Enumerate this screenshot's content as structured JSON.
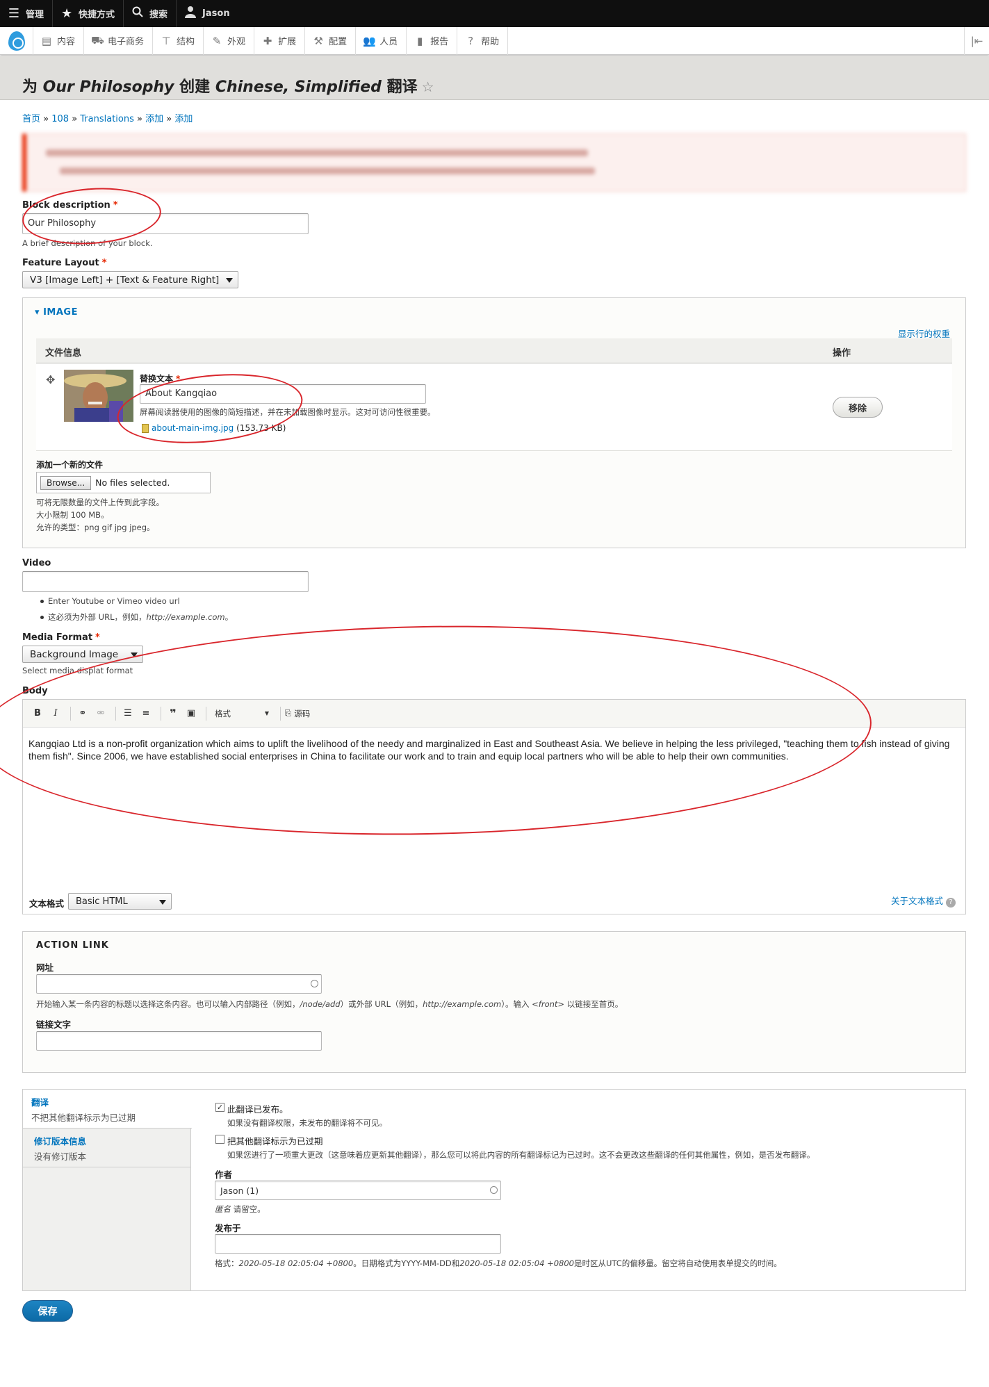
{
  "toolbar": {
    "manage": "管理",
    "shortcuts": "快捷方式",
    "search": "搜索",
    "user": "Jason",
    "menu": [
      {
        "label": "内容",
        "icon": "content-icon"
      },
      {
        "label": "电子商务",
        "icon": "commerce-icon"
      },
      {
        "label": "结构",
        "icon": "structure-icon"
      },
      {
        "label": "外观",
        "icon": "appearance-icon"
      },
      {
        "label": "扩展",
        "icon": "extend-icon"
      },
      {
        "label": "配置",
        "icon": "config-icon"
      },
      {
        "label": "人员",
        "icon": "people-icon"
      },
      {
        "label": "报告",
        "icon": "reports-icon"
      },
      {
        "label": "帮助",
        "icon": "help-icon"
      }
    ]
  },
  "page": {
    "title_prefix": "为 ",
    "title_node": "Our Philosophy",
    "title_mid": " 创建 ",
    "title_lang": "Chinese, Simplified",
    "title_suffix": " 翻译"
  },
  "breadcrumb": [
    "首页",
    "108",
    "Translations",
    "添加",
    "添加"
  ],
  "block_description": {
    "label": "Block description",
    "value": "Our Philosophy",
    "description": "A brief description of your block."
  },
  "feature_layout": {
    "label": "Feature Layout",
    "value": "V3 [Image Left] + [Text & Feature Right]"
  },
  "image": {
    "legend": "IMAGE",
    "show_weights": "显示行的权重",
    "col_file": "文件信息",
    "col_ops": "操作",
    "alt_label": "替换文本",
    "alt_value": "About Kangqiao",
    "alt_desc": "屏幕阅读器使用的图像的简短描述，并在未加载图像时显示。这对可访问性很重要。",
    "file_name": "about-main-img.jpg",
    "file_size": "(153.73 KB)",
    "remove": "移除",
    "add_new": "添加一个新的文件",
    "browse": "Browse...",
    "no_files": "No files selected.",
    "help1": "可将无限数量的文件上传到此字段。",
    "help2": "大小限制 100 MB。",
    "help3": "允许的类型：png gif jpg jpeg。"
  },
  "video": {
    "label": "Video",
    "value": "",
    "desc1": "Enter Youtube or Vimeo video url",
    "desc2_a": "这必须为外部 URL，例如，",
    "desc2_b": "http://example.com",
    "desc2_c": "。"
  },
  "media_format": {
    "label": "Media Format",
    "value": "Background Image",
    "desc": "Select media displat format"
  },
  "body": {
    "label": "Body",
    "format_dropdown": "格式",
    "source": "源码",
    "text": "Kangqiao Ltd is a non-profit organization which aims to uplift the livelihood of the needy and marginalized in East and Southeast Asia. We believe in helping the less privileged, \"teaching them to fish instead of giving them fish\". Since 2006, we have established social enterprises in China to facilitate our work and to train and equip local partners who will be able to help their own communities.",
    "text_format_label": "文本格式",
    "text_format_value": "Basic HTML",
    "about_formats": "关于文本格式"
  },
  "action_link": {
    "legend": "ACTION LINK",
    "url_label": "网址",
    "url_value": "",
    "url_desc_a": "开始输入某一条内容的标题以选择这条内容。也可以输入内部路径（例如，",
    "url_desc_b": "/node/add",
    "url_desc_c": "）或外部 URL（例如，",
    "url_desc_d": "http://example.com",
    "url_desc_e": "）。输入 ",
    "url_desc_f": "<front>",
    "url_desc_g": " 以链接至首页。",
    "text_label": "链接文字",
    "text_value": ""
  },
  "translation": {
    "tab1_title": "翻译",
    "tab1_summary": "不把其他翻译标示为已过期",
    "tab2_title": "修订版本信息",
    "tab2_summary": "没有修订版本",
    "published_label": "此翻译已发布。",
    "published_checked": true,
    "published_desc": "如果没有翻译权限，未发布的翻译将不可见。",
    "outdated_label": "把其他翻译标示为已过期",
    "outdated_checked": false,
    "outdated_desc": "如果您进行了一项重大更改（这意味着应更新其他翻译），那么您可以将此内容的所有翻译标记为已过时。这不会更改这些翻译的任何其他属性，例如，是否发布翻译。",
    "author_label": "作者",
    "author_value": "Jason (1)",
    "author_desc_a": "匿名",
    "author_desc_b": " 请留空。",
    "authored_on_label": "发布于",
    "authored_on_value": "",
    "date_desc_a": "格式：",
    "date_desc_b": "2020-05-18 02:05:04 +0800",
    "date_desc_c": "。日期格式为YYYY-MM-DD和",
    "date_desc_d": "2020-05-18 02:05:04 +0800",
    "date_desc_e": "是时区从UTC的偏移量。留空将自动使用表单提交的时间。"
  },
  "save": "保存",
  "colors": {
    "link": "#0074bd",
    "required": "#e62600",
    "annotation": "#d9262c",
    "primary_button": "#0c6aa6"
  }
}
